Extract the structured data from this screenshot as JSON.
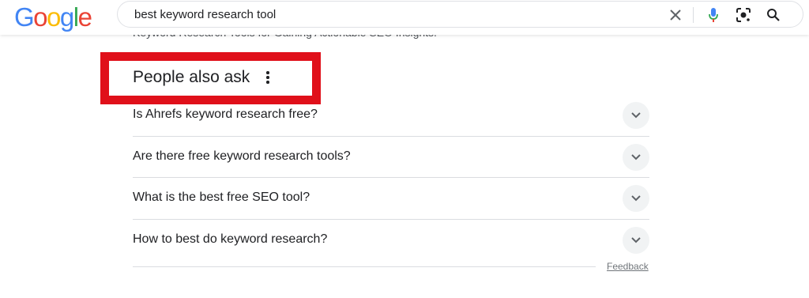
{
  "logo": {
    "letters": [
      "G",
      "o",
      "o",
      "g",
      "l",
      "e"
    ],
    "colors": [
      "#4285f4",
      "#ea4335",
      "#fbbc05",
      "#4285f4",
      "#34a853",
      "#ea4335"
    ]
  },
  "search": {
    "query": "best keyword research tool",
    "icons": [
      "close-icon",
      "microphone-icon",
      "lens-icon",
      "search-icon"
    ]
  },
  "snippet_cutoff": "Keyword Research Tools for Gaining Actionable SEO Insights.",
  "people_also_ask": {
    "title": "People also ask",
    "highlight_color": "#e0101a",
    "questions": [
      "Is Ahrefs keyword research free?",
      "Are there free keyword research tools?",
      "What is the best free SEO tool?",
      "How to best do keyword research?"
    ]
  },
  "feedback_label": "Feedback"
}
